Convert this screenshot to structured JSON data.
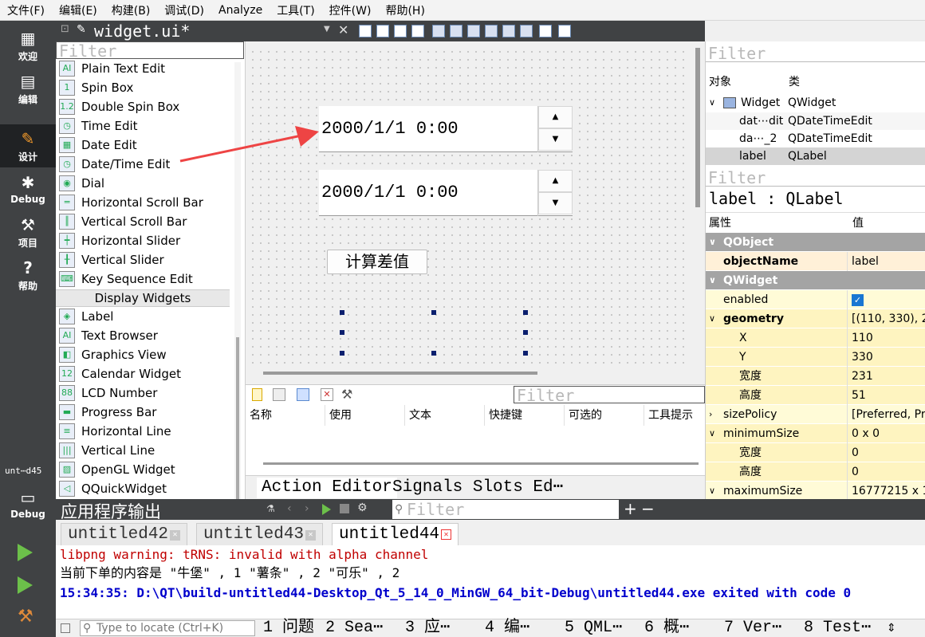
{
  "menu": [
    "文件(F)",
    "编辑(E)",
    "构建(B)",
    "调试(D)",
    "Analyze",
    "工具(T)",
    "控件(W)",
    "帮助(H)"
  ],
  "modes": {
    "welcome": "欢迎",
    "edit": "编辑",
    "design": "设计",
    "debug": "Debug",
    "project": "项目",
    "help": "帮助",
    "target_kit": "unt⋯d45",
    "target_mode": "Debug"
  },
  "doc": {
    "file": "widget.ui*"
  },
  "widget_box": {
    "filter_placeholder": "Filter",
    "items1": [
      "Plain Text Edit",
      "Spin Box",
      "Double Spin Box",
      "Time Edit",
      "Date Edit",
      "Date/Time Edit",
      "Dial",
      "Horizontal Scroll Bar",
      "Vertical Scroll Bar",
      "Horizontal Slider",
      "Vertical Slider",
      "Key Sequence Edit"
    ],
    "category_display": "Display Widgets",
    "items2": [
      "Label",
      "Text Browser",
      "Graphics View",
      "Calendar Widget",
      "LCD Number",
      "Progress Bar",
      "Horizontal Line",
      "Vertical Line",
      "OpenGL Widget",
      "QQuickWidget"
    ]
  },
  "form": {
    "dte1_value": "2000/1/1 0:00",
    "dte2_value": "2000/1/1 0:00",
    "button_label": "计算差值"
  },
  "action_editor": {
    "filter_placeholder": "Filter",
    "columns": [
      "名称",
      "使用",
      "文本",
      "快捷键",
      "可选的",
      "工具提示"
    ],
    "tab_action": "Action Editor",
    "tab_signals": "Signals  Slots Ed⋯"
  },
  "object_inspector": {
    "filter_placeholder": "Filter",
    "col_object": "对象",
    "col_class": "类",
    "rows": [
      {
        "name": "Widget",
        "cls": "QWidget"
      },
      {
        "name": "dat⋯dit",
        "cls": "QDateTimeEdit"
      },
      {
        "name": "da⋯_2",
        "cls": "QDateTimeEdit"
      },
      {
        "name": "label",
        "cls": "QLabel"
      }
    ]
  },
  "property_editor": {
    "filter_placeholder": "Filter",
    "title": "label : QLabel",
    "col_prop": "属性",
    "col_value": "值",
    "rows": [
      {
        "n": "QObject",
        "v": ""
      },
      {
        "n": "objectName",
        "v": "label"
      },
      {
        "n": "QWidget",
        "v": ""
      },
      {
        "n": "enabled",
        "v": ""
      },
      {
        "n": "geometry",
        "v": "[(110, 330), 2"
      },
      {
        "n": "X",
        "v": "110"
      },
      {
        "n": "Y",
        "v": "330"
      },
      {
        "n": "宽度",
        "v": "231"
      },
      {
        "n": "高度",
        "v": "51"
      },
      {
        "n": "sizePolicy",
        "v": "[Preferred, Pr"
      },
      {
        "n": "minimumSize",
        "v": "0 x 0"
      },
      {
        "n": "宽度",
        "v": "0"
      },
      {
        "n": "高度",
        "v": "0"
      },
      {
        "n": "maximumSize",
        "v": "16777215 x 1"
      }
    ]
  },
  "output": {
    "title": "应用程序输出",
    "filter_placeholder": "Filter",
    "tabs": [
      "untitled42",
      "untitled43",
      "untitled44"
    ],
    "lines": [
      "libpng warning: tRNS: invalid with alpha channel",
      "当前下单的内容是 \"牛堡\" , 1 \"薯条\" , 2 \"可乐\" , 2",
      "15:34:35: D:\\QT\\build-untitled44-Desktop_Qt_5_14_0_MinGW_64_bit-Debug\\untitled44.exe exited with code 0"
    ]
  },
  "statusbar": {
    "locate_placeholder": "Type to locate (Ctrl+K)",
    "panes": [
      "1 问题",
      "2 Sea⋯",
      "3 应⋯",
      "4 编⋯",
      "5 QML⋯",
      "6 概⋯",
      "7 Ver⋯",
      "8 Test⋯"
    ]
  },
  "colors": {
    "arrow": "#ee4444",
    "selection": "#d4d4d4",
    "error_text": "#c00000",
    "exit_text": "#0000cc"
  }
}
